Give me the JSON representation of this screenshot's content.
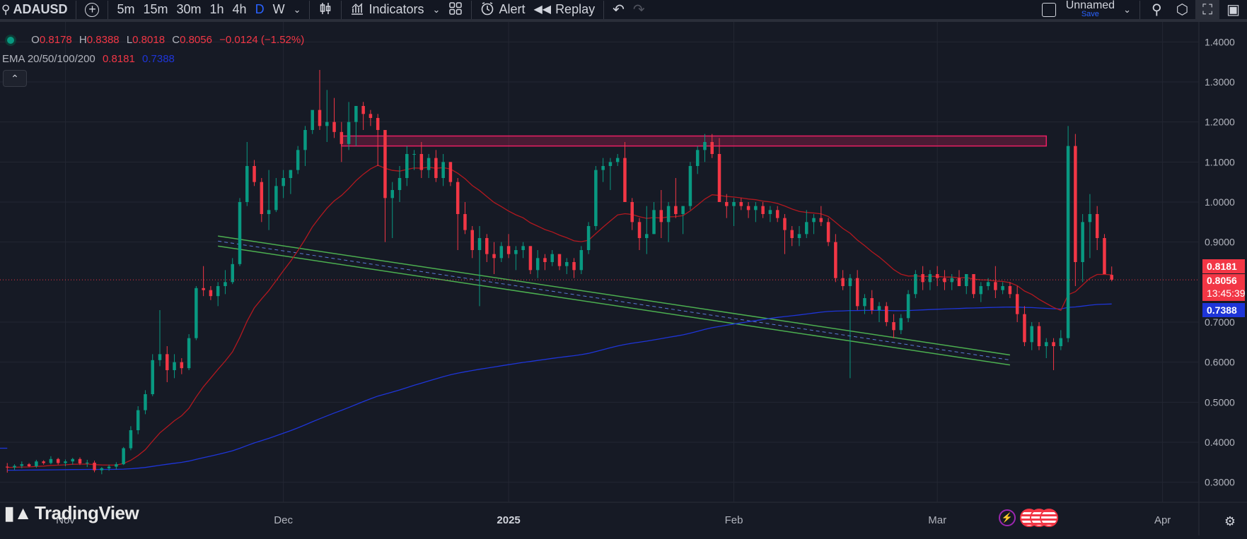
{
  "toolbar": {
    "symbol": "ADAUSD",
    "intervals": [
      "5m",
      "15m",
      "30m",
      "1h",
      "4h",
      "D",
      "W"
    ],
    "active_interval": "D",
    "indicators": "Indicators",
    "alert": "Alert",
    "replay": "Replay",
    "layout_name": "Unnamed",
    "save_label": "Save",
    "icons": [
      "search-icon",
      "add-icon",
      "candles-icon",
      "indicators-icon",
      "templates-icon",
      "alert-icon",
      "replay-icon",
      "undo-icon",
      "redo-icon",
      "layout-icon",
      "quick-search-icon",
      "settings-icon",
      "fullscreen-icon",
      "camera-icon"
    ]
  },
  "legend": {
    "o_label": "O",
    "o": "0.8178",
    "h_label": "H",
    "h": "0.8388",
    "l_label": "L",
    "l": "0.8018",
    "c_label": "C",
    "c": "0.8056",
    "change": "−0.0124 (−1.52%)",
    "ema_label": "EMA 20/50/100/200",
    "ema1": "0.8181",
    "ema2": "0.7388"
  },
  "price_axis": {
    "ticks": [
      "1.4000",
      "1.3000",
      "1.2000",
      "1.1000",
      "1.0000",
      "0.9000",
      "0.7000",
      "0.6000",
      "0.5000",
      "0.4000",
      "0.3000"
    ],
    "ema_tag": "0.8181",
    "price_tag": "0.8056",
    "countdown": "13:45:39",
    "ema_slow_tag": "0.7388"
  },
  "time_axis": {
    "labels": [
      "Nov",
      "Dec",
      "2025",
      "Feb",
      "Mar",
      "Apr"
    ]
  },
  "brand": "TradingView",
  "colors": {
    "bg": "#161a25",
    "up": "#089981",
    "down": "#f23645",
    "ema_fast": "#b2181f",
    "ema_slow": "#1e35d8",
    "resistance": "#e91e63",
    "channel": "#4caf50"
  },
  "chart_data": {
    "type": "candlestick",
    "symbol": "ADAUSD",
    "interval": "D",
    "y_range": [
      0.25,
      1.45
    ],
    "x_range": [
      "2024-10-23",
      "2025-04-06"
    ],
    "x_ticks": [
      "2024-11-01",
      "2024-12-01",
      "2025-01-01",
      "2025-02-01",
      "2025-03-01",
      "2025-04-01"
    ],
    "start_date": "2024-10-24",
    "ohlc": [
      [
        0.339,
        0.348,
        0.324,
        0.337
      ],
      [
        0.337,
        0.345,
        0.33,
        0.341
      ],
      [
        0.341,
        0.352,
        0.335,
        0.345
      ],
      [
        0.345,
        0.348,
        0.338,
        0.34
      ],
      [
        0.34,
        0.356,
        0.336,
        0.352
      ],
      [
        0.352,
        0.355,
        0.344,
        0.348
      ],
      [
        0.348,
        0.365,
        0.345,
        0.358
      ],
      [
        0.358,
        0.361,
        0.344,
        0.348
      ],
      [
        0.348,
        0.357,
        0.34,
        0.352
      ],
      [
        0.352,
        0.361,
        0.344,
        0.358
      ],
      [
        0.358,
        0.362,
        0.343,
        0.347
      ],
      [
        0.347,
        0.356,
        0.338,
        0.349
      ],
      [
        0.349,
        0.354,
        0.325,
        0.33
      ],
      [
        0.33,
        0.338,
        0.32,
        0.335
      ],
      [
        0.335,
        0.344,
        0.329,
        0.339
      ],
      [
        0.339,
        0.35,
        0.332,
        0.345
      ],
      [
        0.345,
        0.388,
        0.343,
        0.385
      ],
      [
        0.385,
        0.44,
        0.38,
        0.43
      ],
      [
        0.43,
        0.49,
        0.42,
        0.48
      ],
      [
        0.48,
        0.53,
        0.47,
        0.52
      ],
      [
        0.52,
        0.62,
        0.515,
        0.605
      ],
      [
        0.605,
        0.73,
        0.59,
        0.62
      ],
      [
        0.62,
        0.64,
        0.55,
        0.58
      ],
      [
        0.58,
        0.62,
        0.56,
        0.6
      ],
      [
        0.6,
        0.61,
        0.57,
        0.585
      ],
      [
        0.585,
        0.67,
        0.58,
        0.66
      ],
      [
        0.66,
        0.79,
        0.655,
        0.785
      ],
      [
        0.785,
        0.84,
        0.765,
        0.78
      ],
      [
        0.78,
        0.79,
        0.755,
        0.765
      ],
      [
        0.765,
        0.8,
        0.74,
        0.79
      ],
      [
        0.79,
        0.83,
        0.77,
        0.8
      ],
      [
        0.8,
        0.86,
        0.795,
        0.845
      ],
      [
        0.845,
        1.01,
        0.84,
        1.0
      ],
      [
        1.0,
        1.15,
        0.99,
        1.09
      ],
      [
        1.09,
        1.105,
        1.04,
        1.05
      ],
      [
        1.05,
        1.06,
        0.95,
        0.97
      ],
      [
        0.97,
        1.08,
        0.93,
        0.98
      ],
      [
        0.98,
        1.06,
        0.975,
        1.04
      ],
      [
        1.04,
        1.08,
        1.01,
        1.06
      ],
      [
        1.06,
        1.08,
        1.02,
        1.08
      ],
      [
        1.08,
        1.14,
        1.07,
        1.13
      ],
      [
        1.13,
        1.19,
        1.09,
        1.18
      ],
      [
        1.18,
        1.22,
        1.17,
        1.23
      ],
      [
        1.23,
        1.33,
        1.18,
        1.19
      ],
      [
        1.19,
        1.28,
        1.15,
        1.2
      ],
      [
        1.2,
        1.26,
        1.16,
        1.175
      ],
      [
        1.175,
        1.2,
        1.1,
        1.145
      ],
      [
        1.145,
        1.25,
        1.13,
        1.2
      ],
      [
        1.2,
        1.23,
        1.14,
        1.24
      ],
      [
        1.24,
        1.25,
        1.18,
        1.22
      ],
      [
        1.22,
        1.23,
        1.19,
        1.21
      ],
      [
        1.21,
        1.22,
        1.09,
        1.18
      ],
      [
        1.18,
        1.16,
        0.9,
        1.01
      ],
      [
        1.01,
        1.05,
        0.91,
        1.03
      ],
      [
        1.03,
        1.09,
        1.0,
        1.06
      ],
      [
        1.06,
        1.14,
        1.04,
        1.12
      ],
      [
        1.12,
        1.13,
        1.08,
        1.12
      ],
      [
        1.12,
        1.15,
        1.06,
        1.08
      ],
      [
        1.08,
        1.12,
        1.06,
        1.11
      ],
      [
        1.11,
        1.13,
        1.05,
        1.06
      ],
      [
        1.06,
        1.12,
        1.04,
        1.1
      ],
      [
        1.1,
        1.1,
        1.04,
        1.05
      ],
      [
        1.05,
        1.06,
        0.88,
        0.97
      ],
      [
        0.97,
        1.0,
        0.92,
        0.93
      ],
      [
        0.93,
        0.94,
        0.86,
        0.88
      ],
      [
        0.88,
        0.94,
        0.74,
        0.91
      ],
      [
        0.91,
        0.92,
        0.85,
        0.87
      ],
      [
        0.87,
        0.9,
        0.82,
        0.86
      ],
      [
        0.86,
        0.9,
        0.85,
        0.89
      ],
      [
        0.89,
        0.92,
        0.86,
        0.87
      ],
      [
        0.87,
        0.89,
        0.83,
        0.88
      ],
      [
        0.88,
        0.9,
        0.86,
        0.89
      ],
      [
        0.89,
        0.89,
        0.82,
        0.83
      ],
      [
        0.83,
        0.88,
        0.81,
        0.86
      ],
      [
        0.86,
        0.87,
        0.83,
        0.85
      ],
      [
        0.85,
        0.88,
        0.84,
        0.87
      ],
      [
        0.87,
        0.87,
        0.83,
        0.84
      ],
      [
        0.84,
        0.86,
        0.82,
        0.85
      ],
      [
        0.85,
        0.86,
        0.81,
        0.83
      ],
      [
        0.83,
        0.89,
        0.82,
        0.88
      ],
      [
        0.88,
        0.95,
        0.87,
        0.94
      ],
      [
        0.94,
        1.09,
        0.93,
        1.08
      ],
      [
        1.08,
        1.11,
        1.05,
        1.09
      ],
      [
        1.09,
        1.11,
        1.03,
        1.1
      ],
      [
        1.1,
        1.12,
        1.09,
        1.11
      ],
      [
        1.11,
        1.15,
        1.04,
        1.0
      ],
      [
        1.0,
        1.01,
        0.93,
        0.95
      ],
      [
        0.95,
        0.96,
        0.88,
        0.91
      ],
      [
        0.91,
        0.99,
        0.87,
        0.92
      ],
      [
        0.92,
        1.0,
        0.92,
        0.98
      ],
      [
        0.98,
        1.03,
        0.91,
        0.95
      ],
      [
        0.95,
        1.0,
        0.9,
        0.99
      ],
      [
        0.99,
        1.06,
        0.96,
        0.97
      ],
      [
        0.97,
        0.99,
        0.92,
        0.99
      ],
      [
        0.99,
        1.1,
        0.98,
        1.09
      ],
      [
        1.09,
        1.14,
        1.07,
        1.13
      ],
      [
        1.13,
        1.17,
        1.1,
        1.15
      ],
      [
        1.15,
        1.17,
        1.11,
        1.12
      ],
      [
        1.12,
        1.16,
        1.01,
        1.0
      ],
      [
        1.0,
        1.02,
        0.96,
        0.99
      ],
      [
        0.99,
        1.01,
        0.94,
        1.0
      ],
      [
        1.0,
        1.01,
        0.98,
        0.99
      ],
      [
        0.99,
        1.0,
        0.96,
        0.98
      ],
      [
        0.98,
        1.0,
        0.95,
        0.99
      ],
      [
        0.99,
        1.0,
        0.96,
        0.97
      ],
      [
        0.97,
        0.99,
        0.95,
        0.98
      ],
      [
        0.98,
        0.99,
        0.95,
        0.96
      ],
      [
        0.96,
        0.97,
        0.87,
        0.93
      ],
      [
        0.93,
        0.94,
        0.89,
        0.91
      ],
      [
        0.91,
        0.94,
        0.89,
        0.92
      ],
      [
        0.92,
        0.98,
        0.91,
        0.95
      ],
      [
        0.95,
        0.97,
        0.92,
        0.96
      ],
      [
        0.96,
        0.99,
        0.94,
        0.95
      ],
      [
        0.95,
        0.96,
        0.89,
        0.9
      ],
      [
        0.9,
        0.92,
        0.8,
        0.81
      ],
      [
        0.81,
        0.83,
        0.78,
        0.79
      ],
      [
        0.79,
        0.82,
        0.56,
        0.81
      ],
      [
        0.81,
        0.83,
        0.73,
        0.74
      ],
      [
        0.74,
        0.77,
        0.72,
        0.76
      ],
      [
        0.76,
        0.78,
        0.72,
        0.73
      ],
      [
        0.73,
        0.75,
        0.7,
        0.74
      ],
      [
        0.74,
        0.75,
        0.69,
        0.7
      ],
      [
        0.7,
        0.72,
        0.66,
        0.68
      ],
      [
        0.68,
        0.72,
        0.67,
        0.71
      ],
      [
        0.71,
        0.78,
        0.7,
        0.77
      ],
      [
        0.77,
        0.83,
        0.76,
        0.82
      ],
      [
        0.82,
        0.84,
        0.78,
        0.8
      ],
      [
        0.8,
        0.83,
        0.78,
        0.82
      ],
      [
        0.82,
        0.84,
        0.79,
        0.81
      ],
      [
        0.81,
        0.83,
        0.78,
        0.8
      ],
      [
        0.8,
        0.82,
        0.78,
        0.81
      ],
      [
        0.81,
        0.83,
        0.79,
        0.79
      ],
      [
        0.79,
        0.82,
        0.77,
        0.82
      ],
      [
        0.82,
        0.82,
        0.76,
        0.77
      ],
      [
        0.77,
        0.8,
        0.75,
        0.79
      ],
      [
        0.79,
        0.81,
        0.78,
        0.8
      ],
      [
        0.8,
        0.84,
        0.76,
        0.78
      ],
      [
        0.78,
        0.8,
        0.77,
        0.79
      ],
      [
        0.79,
        0.8,
        0.76,
        0.77
      ],
      [
        0.77,
        0.79,
        0.7,
        0.72
      ],
      [
        0.72,
        0.74,
        0.64,
        0.65
      ],
      [
        0.65,
        0.7,
        0.63,
        0.69
      ],
      [
        0.69,
        0.7,
        0.63,
        0.64
      ],
      [
        0.64,
        0.66,
        0.61,
        0.65
      ],
      [
        0.65,
        0.66,
        0.58,
        0.64
      ],
      [
        0.64,
        0.68,
        0.63,
        0.66
      ],
      [
        0.66,
        1.19,
        0.65,
        1.14
      ],
      [
        1.14,
        1.17,
        0.79,
        0.85
      ],
      [
        0.85,
        0.97,
        0.8,
        0.95
      ],
      [
        0.95,
        1.02,
        0.86,
        0.97
      ],
      [
        0.97,
        0.99,
        0.88,
        0.91
      ],
      [
        0.91,
        0.92,
        0.82,
        0.82
      ],
      [
        0.818,
        0.839,
        0.802,
        0.806
      ]
    ],
    "ema_fast": {
      "name": "EMA 20",
      "last": 0.8181
    },
    "ema_slow": {
      "name": "EMA 200",
      "last": 0.7388
    },
    "resistance_zone": [
      1.14,
      1.165
    ],
    "last_price": 0.8056
  }
}
